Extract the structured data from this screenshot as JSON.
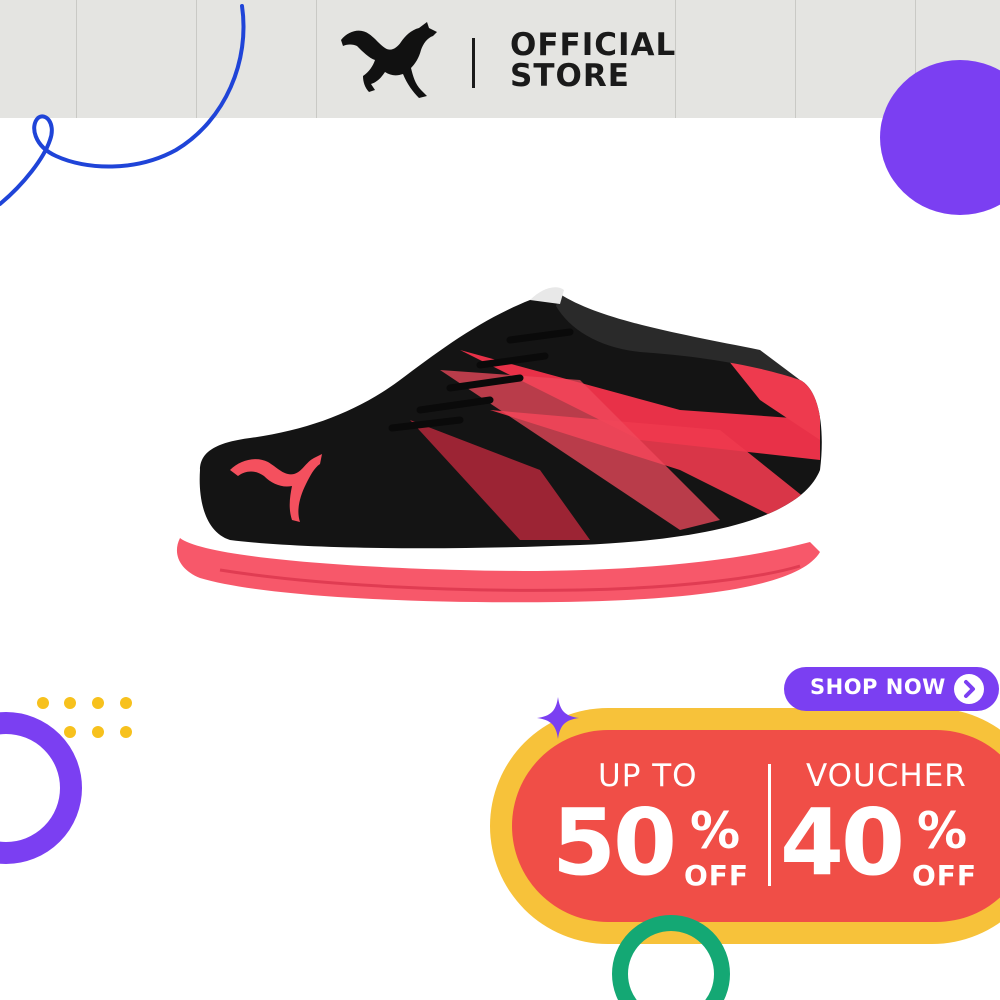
{
  "header": {
    "brand_logo_icon": "puma-cat-logo-icon",
    "store_line1": "OFFICIAL",
    "store_line2": "STORE"
  },
  "product": {
    "image_icon": "futsal-shoe-image",
    "colors": {
      "upper": "#141414",
      "accent": "#ee3a4e",
      "sole": "#f7586a"
    }
  },
  "promo": {
    "shop_now_label": "SHOP NOW",
    "shop_now_icon": "chevron-right-icon",
    "discount_prefix": "UP TO",
    "discount_value": "50",
    "discount_percent": "%",
    "discount_suffix": "OFF",
    "voucher_label": "VOUCHER",
    "voucher_value": "40",
    "voucher_percent": "%",
    "voucher_suffix": "OFF"
  },
  "colors": {
    "header_bg": "#e4e4e1",
    "purple": "#7b3ff2",
    "yellow": "#f7c23a",
    "red": "#f04e47",
    "green": "#14a874",
    "blue_line": "#1f44d8"
  }
}
